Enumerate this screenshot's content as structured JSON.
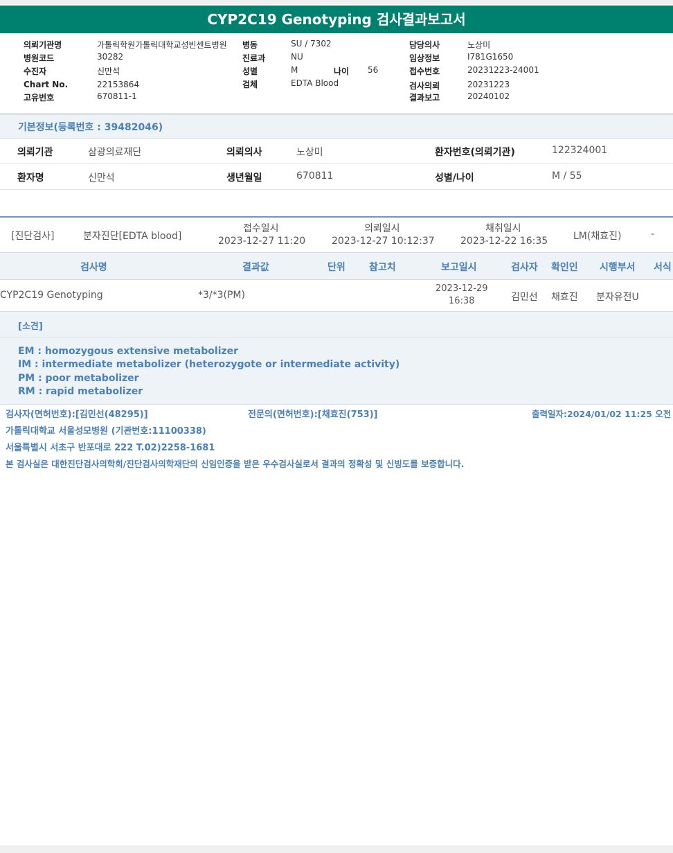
{
  "report": {
    "title": "CYP2C19 Genotyping 검사결과보고서"
  },
  "header": {
    "institution_label": "의뢰기관명",
    "institution_value": "가톨릭학원가톨릭대학교성빈센트병원",
    "hospital_code_label": "병원코드",
    "hospital_code_value": "30282",
    "patient_label": "수진자",
    "patient_value": "신만석",
    "chart_label": "Chart No.",
    "chart_value": "22153864",
    "unique_label": "고유번호",
    "unique_value": "670811-1",
    "ward_label": "병동",
    "ward_value": "SU / 7302",
    "dept_label": "진료과",
    "dept_value": "NU",
    "sex_label": "성별",
    "sex_value": "M",
    "age_label": "나이",
    "age_value": "56",
    "specimen_label": "검체",
    "specimen_value": "EDTA Blood",
    "doctor_label": "담당의사",
    "doctor_value": "노상미",
    "clinical_label": "임상정보",
    "clinical_value": "I781G1650",
    "receipt_no_label": "접수번호",
    "receipt_no_value": "20231223-24001",
    "request_date_label": "검사의뢰",
    "request_date_value": "20231223",
    "report_date_label": "결과보고",
    "report_date_value": "20240102"
  },
  "basic": {
    "title": "기본정보(등록번호 : 39482046)",
    "req_org_label": "의뢰기관",
    "req_org_value": "삼광의료재단",
    "req_doctor_label": "의뢰의사",
    "req_doctor_value": "노상미",
    "patient_no_label": "환자번호(의뢰기관)",
    "patient_no_value": "122324001",
    "name_label": "환자명",
    "name_value": "신만석",
    "birth_label": "생년월일",
    "birth_value": "670811",
    "sexage_label": "성별/나이",
    "sexage_value": "M / 55"
  },
  "exam": {
    "category": "[진단검사]",
    "type": "분자진단[EDTA blood]",
    "receipt_label": "접수일시",
    "receipt_value": "2023-12-27 11:20",
    "request_label": "의뢰일시",
    "request_value": "2023-12-27 10:12:37",
    "collect_label": "채취일시",
    "collect_value": "2023-12-22 16:35",
    "lm": "LM(채효진)",
    "dash": "-"
  },
  "results": {
    "headers": [
      "검사명",
      "결과값",
      "단위",
      "참고치",
      "보고일시",
      "검사자",
      "확인인",
      "시행부서",
      "서식"
    ],
    "row": {
      "name": "CYP2C19 Genotyping",
      "value": "*3/*3(PM)",
      "report_date": "2023-12-29",
      "report_time": "16:38",
      "tester": "김민선",
      "checker": "채효진",
      "dept": "분자유전U"
    }
  },
  "findings": {
    "title": "[소견]",
    "lines": [
      "EM : homozygous extensive metabolizer",
      "IM  : intermediate metabolizer (heterozygote or intermediate activity)",
      "PM : poor metabolizer",
      "RM : rapid metabolizer"
    ]
  },
  "footer": {
    "tester": "검사자(면허번호):[김민선(48295)]",
    "specialist": "전문의(면허번호):[채효진(753)]",
    "print_date": "출력일자:2024/01/02 11:25 오전",
    "hospital": "가톨릭대학교 서울성모병원 (기관번호:11100338)",
    "address": "서울특별시 서초구 반포대로 222 T.02)2258-1681",
    "cert": "본 검사실은 대한진단검사의학회/진단검사의학재단의 신임인증을 받은 우수검사실로서 결과의 정확성 및 신빙도를 보증합니다."
  }
}
